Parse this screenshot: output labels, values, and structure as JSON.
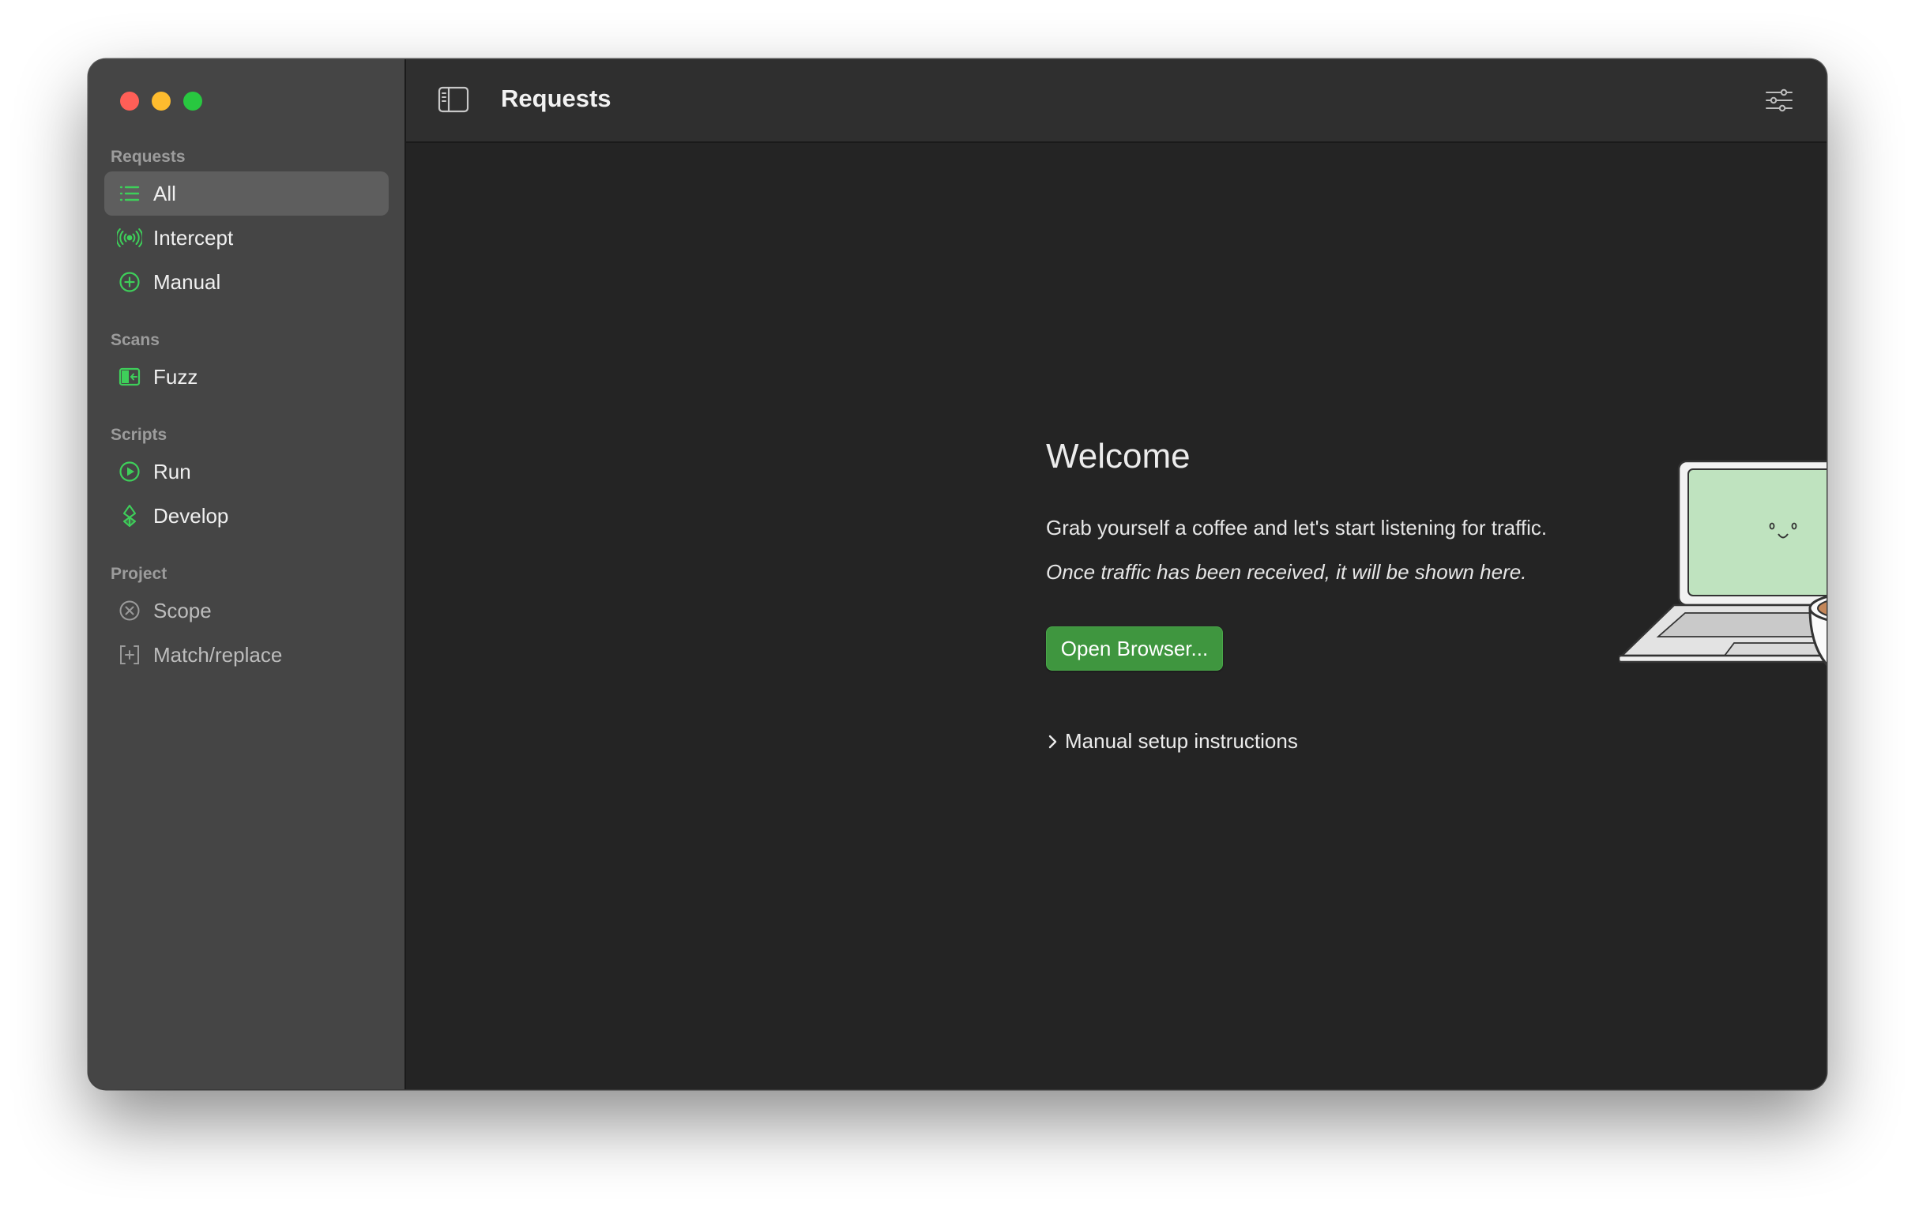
{
  "window": {
    "traffic_lights": [
      "close",
      "minimize",
      "zoom"
    ]
  },
  "sidebar": {
    "sections": [
      {
        "title": "Requests",
        "items": [
          {
            "label": "All",
            "icon": "list-icon",
            "selected": true
          },
          {
            "label": "Intercept",
            "icon": "broadcast-icon"
          },
          {
            "label": "Manual",
            "icon": "plus-circle-icon"
          }
        ]
      },
      {
        "title": "Scans",
        "items": [
          {
            "label": "Fuzz",
            "icon": "fuzz-icon"
          }
        ]
      },
      {
        "title": "Scripts",
        "items": [
          {
            "label": "Run",
            "icon": "play-circle-icon"
          },
          {
            "label": "Develop",
            "icon": "code-icon"
          }
        ]
      },
      {
        "title": "Project",
        "items": [
          {
            "label": "Scope",
            "icon": "x-circle-icon"
          },
          {
            "label": "Match/replace",
            "icon": "bracket-plus-icon"
          }
        ]
      }
    ]
  },
  "toolbar": {
    "title": "Requests",
    "left_icon": "sidebar-toggle-icon",
    "right_icon": "sliders-icon"
  },
  "welcome": {
    "title": "Welcome",
    "line": "Grab yourself a coffee and let's start listening for traffic.",
    "note": "Once traffic has been received, it will be shown here.",
    "button_label": "Open Browser...",
    "disclosure_label": "Manual setup instructions"
  },
  "colors": {
    "accent_green": "#3f963f",
    "icon_green": "#3ecf5a",
    "sidebar_bg": "#454545",
    "main_bg": "#242424",
    "toolbar_bg": "#2f2f2f",
    "laptop_screen": "#bfe3bf",
    "coffee": "#c4875a"
  }
}
